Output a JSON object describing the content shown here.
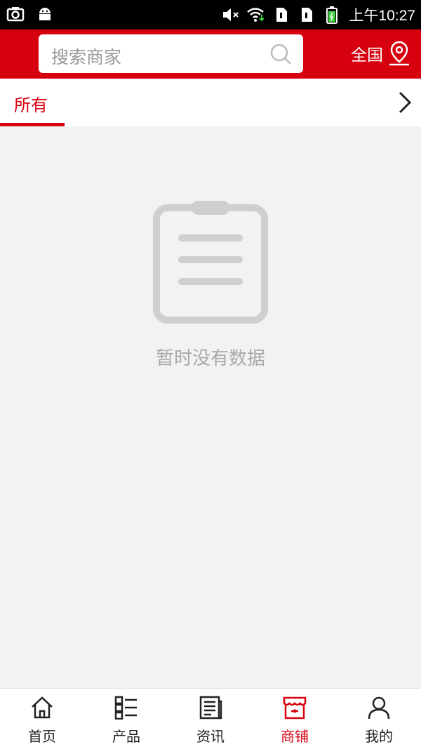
{
  "status_bar": {
    "time": "上午10:27",
    "icons": [
      "screenshot-icon",
      "android-icon",
      "mute-icon",
      "wifi-icon",
      "sim1-icon",
      "sim2-icon",
      "battery-icon"
    ]
  },
  "header": {
    "search_placeholder": "搜索商家",
    "region_label": "全国",
    "accent_color": "#d7000f"
  },
  "tabs": {
    "items": [
      {
        "label": "所有",
        "active": true
      }
    ]
  },
  "empty_state": {
    "message": "暂时没有数据"
  },
  "bottom_nav": {
    "items": [
      {
        "label": "首页",
        "icon": "home-icon",
        "active": false
      },
      {
        "label": "产品",
        "icon": "product-list-icon",
        "active": false
      },
      {
        "label": "资讯",
        "icon": "news-icon",
        "active": false
      },
      {
        "label": "商铺",
        "icon": "shop-icon",
        "active": true
      },
      {
        "label": "我的",
        "icon": "user-icon",
        "active": false
      }
    ]
  }
}
